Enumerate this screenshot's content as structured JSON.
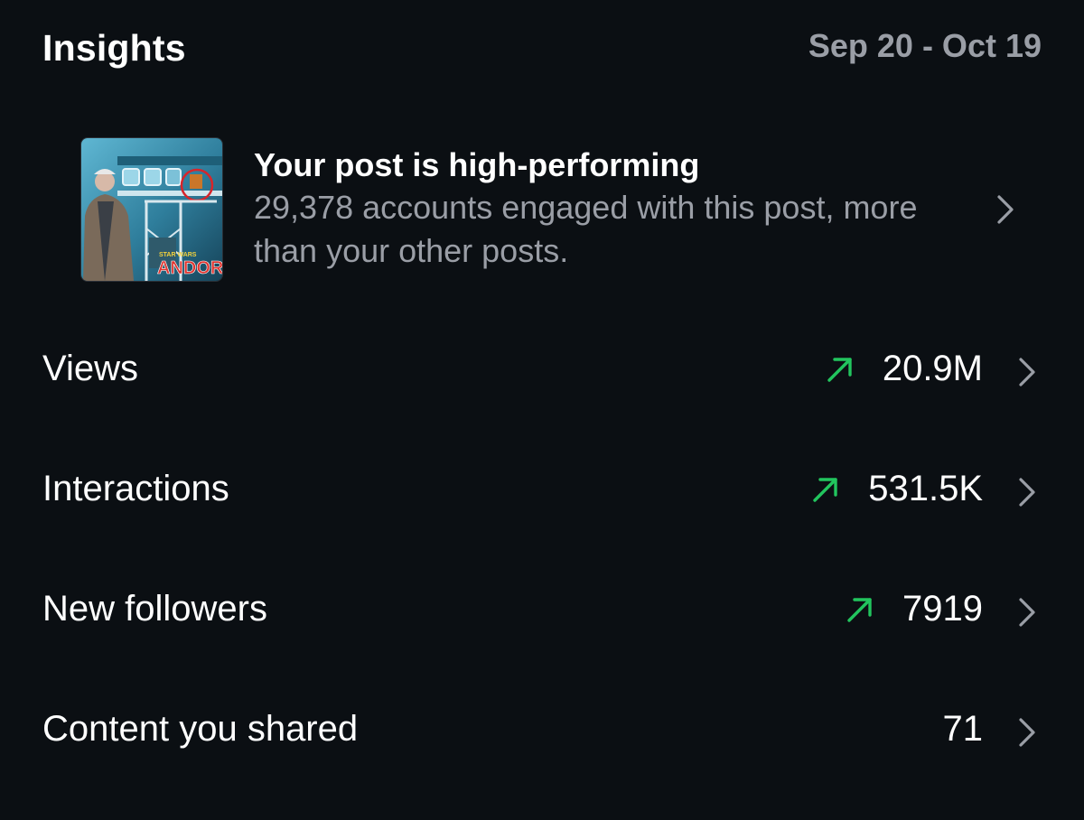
{
  "header": {
    "title": "Insights",
    "date_range": "Sep 20 - Oct 19"
  },
  "highlight": {
    "title": "Your post is high-performing",
    "description": "29,378 accounts engaged with this post, more than your other posts.",
    "thumbnail_text": [
      "STAR WARS",
      "ANDOR"
    ]
  },
  "metrics": [
    {
      "label": "Views",
      "value": "20.9M",
      "trend": "up"
    },
    {
      "label": "Interactions",
      "value": "531.5K",
      "trend": "up"
    },
    {
      "label": "New followers",
      "value": "7919",
      "trend": "up"
    },
    {
      "label": "Content you shared",
      "value": "71",
      "trend": "none"
    }
  ],
  "colors": {
    "background": "#0b0f13",
    "text": "#ffffff",
    "muted": "#9a9ea6",
    "trend_up": "#22c55e",
    "chevron": "#9a9ea6"
  },
  "icons": {
    "trend": "arrow-up-right-icon",
    "chevron": "chevron-right-icon"
  }
}
